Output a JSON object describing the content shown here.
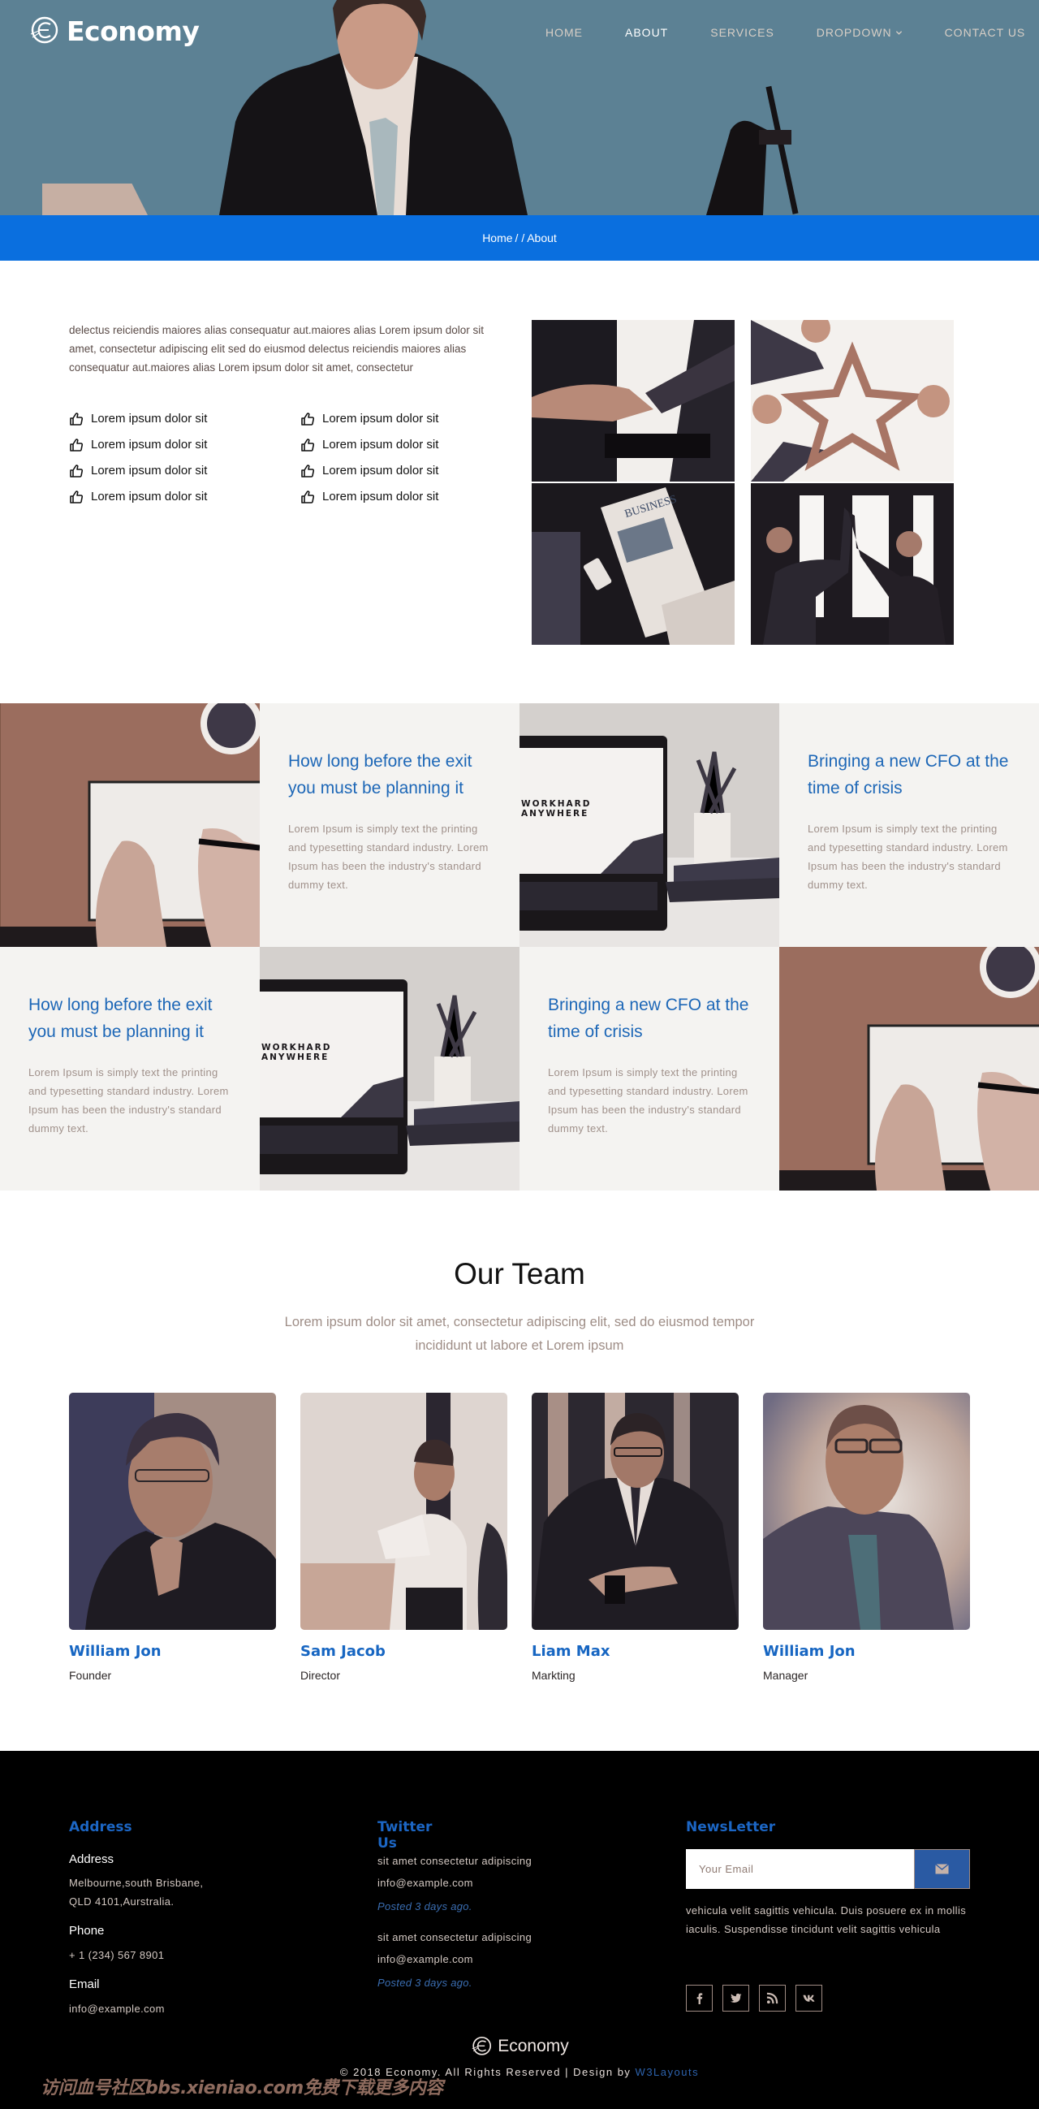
{
  "brand": {
    "name": "Economy",
    "logo_icon": "globe-e-icon"
  },
  "nav": {
    "items": [
      {
        "label": "HOME",
        "active": false
      },
      {
        "label": "ABOUT",
        "active": true
      },
      {
        "label": "SERVICES",
        "active": false
      },
      {
        "label": "DROPDOWN",
        "active": false,
        "has_dropdown": true
      },
      {
        "label": "CONTACT US",
        "active": false
      }
    ],
    "dropdown_icon": "chevron-down-icon"
  },
  "breadcrumb": {
    "home": "Home",
    "separator": "/ /",
    "current": "About"
  },
  "about": {
    "intro": "delectus reiciendis maiores alias consequatur aut.maiores alias Lorem ipsum dolor sit amet, consectetur adipiscing elit sed do eiusmod delectus reiciendis maiores alias consequatur aut.maiores alias Lorem ipsum dolor sit amet, consectetur",
    "features": [
      "Lorem ipsum dolor sit",
      "Lorem ipsum dolor sit",
      "Lorem ipsum dolor sit",
      "Lorem ipsum dolor sit",
      "Lorem ipsum dolor sit",
      "Lorem ipsum dolor sit",
      "Lorem ipsum dolor sit",
      "Lorem ipsum dolor sit"
    ],
    "feature_icon": "thumbs-up-icon",
    "gallery": [
      {
        "subject": "handshake"
      },
      {
        "subject": "team-star-hands"
      },
      {
        "subject": "business-newspaper",
        "caption": "BUSINESS"
      },
      {
        "subject": "high-five"
      }
    ]
  },
  "blog": {
    "tiles": [
      {
        "type": "image",
        "subject": "notebook-writing"
      },
      {
        "type": "text",
        "title": "How long before the exit you must be planning it",
        "body": "Lorem Ipsum is simply text the printing and typesetting standard industry. Lorem Ipsum has been the industry's standard dummy text."
      },
      {
        "type": "image",
        "subject": "laptop-workhard",
        "screen_text": "WORKHARD ANYWHERE"
      },
      {
        "type": "text",
        "title": "Bringing a new CFO at the time of crisis",
        "body": "Lorem Ipsum is simply text the printing and typesetting standard industry. Lorem Ipsum has been the industry's standard dummy text."
      },
      {
        "type": "text",
        "title": "How long before the exit you must be planning it",
        "body": "Lorem Ipsum is simply text the printing and typesetting standard industry. Lorem Ipsum has been the industry's standard dummy text."
      },
      {
        "type": "image",
        "subject": "laptop-workhard",
        "screen_text": "WORKHARD ANYWHERE"
      },
      {
        "type": "text",
        "title": "Bringing a new CFO at the time of crisis",
        "body": "Lorem Ipsum is simply text the printing and typesetting standard industry. Lorem Ipsum has been the industry's standard dummy text."
      },
      {
        "type": "image",
        "subject": "notebook-writing"
      }
    ]
  },
  "team": {
    "title": "Our Team",
    "subtitle": "Lorem ipsum dolor sit amet, consectetur adipiscing elit, sed do eiusmod tempor incididunt ut labore et Lorem ipsum",
    "members": [
      {
        "name": "William Jon",
        "role": "Founder"
      },
      {
        "name": "Sam Jacob",
        "role": "Director"
      },
      {
        "name": "Liam Max",
        "role": "Markting"
      },
      {
        "name": "William Jon",
        "role": "Manager"
      }
    ]
  },
  "footer": {
    "address": {
      "heading": "Address",
      "address_label": "Address",
      "address_line1": "Melbourne,south Brisbane,",
      "address_line2": "QLD 4101,Aurstralia.",
      "phone_label": "Phone",
      "phone": "+ 1 (234) 567 8901",
      "email_label": "Email",
      "email": "info@example.com"
    },
    "twitter": {
      "heading": "Twitter Us",
      "posts": [
        {
          "text": "sit amet consectetur adipiscing",
          "email": "info@example.com",
          "posted": "Posted 3 days ago."
        },
        {
          "text": "sit amet consectetur adipiscing",
          "email": "info@example.com",
          "posted": "Posted 3 days ago."
        }
      ]
    },
    "newsletter": {
      "heading": "NewsLetter",
      "email_placeholder": "Your Email",
      "email_value": "",
      "submit_icon": "envelope-icon",
      "text": "vehicula velit sagittis vehicula. Duis posuere ex in mollis iaculis. Suspendisse tincidunt velit sagittis vehicula",
      "socials": [
        "facebook-icon",
        "twitter-icon",
        "rss-icon",
        "vk-icon"
      ]
    },
    "bottom": {
      "logo_text": "Economy",
      "copyright_prefix": "© 2018 Economy. All Rights Reserved | Design by ",
      "designer": "W3Layouts"
    }
  },
  "watermark": "访问血号社区bbs.xieniao.com免费下载更多内容",
  "colors": {
    "accent_blue": "#0a6fdf",
    "heading_blue": "#1d67b7",
    "hero_bg": "#5c8194",
    "footer_bg": "#000000"
  }
}
